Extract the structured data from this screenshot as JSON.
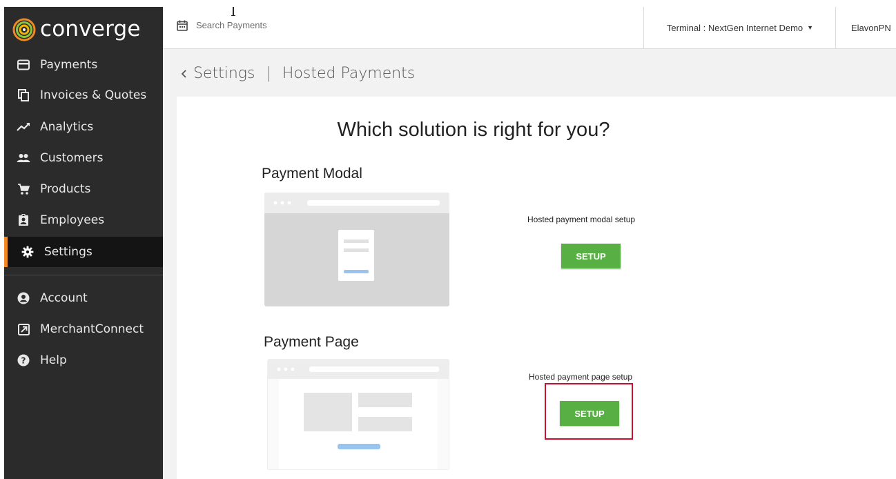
{
  "brand": {
    "name": "converge",
    "accent_color": "#f08a24",
    "logo_icon": "converge-logo-icon"
  },
  "sidebar": {
    "items": [
      {
        "label": "Payments",
        "icon": "card-icon"
      },
      {
        "label": "Invoices & Quotes",
        "icon": "copy-icon"
      },
      {
        "label": "Analytics",
        "icon": "trend-icon"
      },
      {
        "label": "Customers",
        "icon": "people-icon"
      },
      {
        "label": "Products",
        "icon": "cart-icon"
      },
      {
        "label": "Employees",
        "icon": "badge-icon"
      },
      {
        "label": "Settings",
        "icon": "gear-icon",
        "active": true
      },
      {
        "label": "Account",
        "icon": "user-circle-icon"
      },
      {
        "label": "MerchantConnect",
        "icon": "external-link-icon"
      },
      {
        "label": "Help",
        "icon": "help-icon"
      }
    ]
  },
  "topbar": {
    "search_placeholder": "Search Payments",
    "terminal_label": "Terminal : NextGen Internet Demo",
    "user_label": "ElavonPN"
  },
  "breadcrumb": {
    "parent": "Settings",
    "current": "Hosted Payments"
  },
  "main": {
    "heading": "Which solution is right for you?",
    "options": [
      {
        "title": "Payment Modal",
        "setup_label": "Hosted payment modal setup",
        "button_label": "SETUP"
      },
      {
        "title": "Payment Page",
        "setup_label": "Hosted payment page setup",
        "button_label": "SETUP"
      }
    ]
  },
  "colors": {
    "sidebar_bg": "#2b2b2b",
    "button_green": "#58b044",
    "highlight_red": "#c8102e"
  }
}
